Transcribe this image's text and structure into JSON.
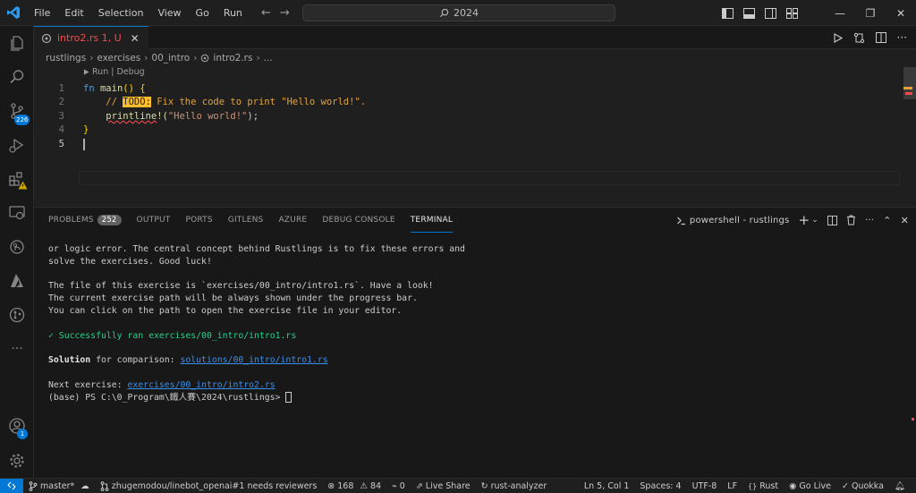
{
  "titlebar": {
    "menu": [
      "File",
      "Edit",
      "Selection",
      "View",
      "Go",
      "Run"
    ],
    "search_text": "2024"
  },
  "activity": {
    "scm_badge": "226",
    "accounts_badge": "1"
  },
  "editor": {
    "tab": {
      "filename": "intro2.rs",
      "status": "1, U"
    },
    "breadcrumb": [
      "rustlings",
      "exercises",
      "00_intro",
      "intro2.rs",
      "..."
    ],
    "codelens": "Run | Debug",
    "lines": {
      "l1": {
        "num": "1",
        "kw": "fn",
        "fn": "main",
        "rest": "() {"
      },
      "l2": {
        "num": "2",
        "pre": "// ",
        "todo": "TODO:",
        "post": " Fix the code to print \"Hello world!\"."
      },
      "l3": {
        "num": "3",
        "macro": "printline",
        "bang": "!(",
        "str": "\"Hello world!\"",
        "end": ");"
      },
      "l4": {
        "num": "4",
        "brace": "}"
      },
      "l5": {
        "num": "5"
      }
    }
  },
  "panel": {
    "tabs": [
      {
        "label": "PROBLEMS",
        "count": "252"
      },
      {
        "label": "OUTPUT"
      },
      {
        "label": "PORTS"
      },
      {
        "label": "GITLENS"
      },
      {
        "label": "AZURE"
      },
      {
        "label": "DEBUG CONSOLE"
      },
      {
        "label": "TERMINAL"
      }
    ],
    "terminal_name": "powershell - rustlings",
    "terminal": {
      "t1": "or logic error. The central concept behind Rustlings is to fix these errors and",
      "t2": "solve the exercises. Good luck!",
      "t4": "The file of this exercise is `exercises/00_intro/intro1.rs`. Have a look!",
      "t5": "The current exercise path will be always shown under the progress bar.",
      "t6": "You can click on the path to open the exercise file in your editor.",
      "t8": "✓ Successfully ran exercises/00_intro/intro1.rs",
      "t10_label": "Solution",
      "t10_mid": " for comparison: ",
      "t10_link": "solutions/00_intro/intro1.rs",
      "t12_label": "Next exercise: ",
      "t12_link": "exercises/00_intro/intro2.rs",
      "t13": "(base) PS C:\\0_Program\\鐵人賽\\2024\\rustlings> "
    }
  },
  "statusbar": {
    "branch": "master*",
    "pr": "zhugemodou/linebot_openai#1 needs reviewers",
    "errors": "168",
    "warnings": "84",
    "ports": "0",
    "liveshare": "Live Share",
    "analyzer": "rust-analyzer",
    "position": "Ln 5, Col 1",
    "spaces": "Spaces: 4",
    "encoding": "UTF-8",
    "eol": "LF",
    "language": "Rust",
    "golive": "Go Live",
    "quokka": "Quokka"
  },
  "colors": {
    "accent": "#0078d4",
    "error": "#f14c4c",
    "success": "#23d18b",
    "link": "#3b8eea"
  }
}
